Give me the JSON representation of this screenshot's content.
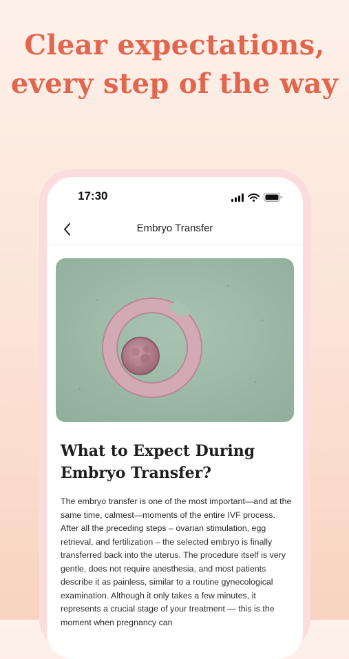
{
  "headline": "Clear expectations, every step of the way",
  "status_bar": {
    "time": "17:30"
  },
  "nav": {
    "title": "Embryo Transfer"
  },
  "article": {
    "title": "What to Expect During Embryo Transfer?",
    "body": "The embryo transfer is one of the most important—and at the same time, calmest—moments of the entire IVF process. After all the preceding steps – ovarian stimulation, egg retrieval, and fertilization – the selected embryo is finally transferred back into the uterus. The procedure itself is very gentle, does not require anesthesia, and most patients describe it as painless, similar to a routine gynecological examination. Although it only takes a few minutes, it represents a crucial stage of your treatment — this is the moment when pregnancy can"
  },
  "colors": {
    "headline": "#e2664e",
    "background_top": "#fdf1ea",
    "background_bottom": "#f9d3c0",
    "phone_frame": "#fcdcdc",
    "hero_background": "#9bb8a6"
  },
  "icons": [
    "signal-icon",
    "wifi-icon",
    "battery-icon",
    "chevron-left-icon"
  ]
}
